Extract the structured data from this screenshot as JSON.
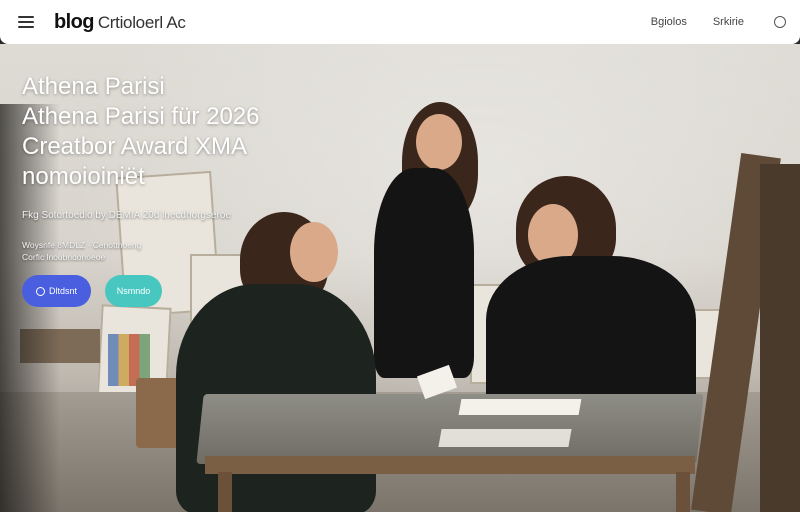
{
  "header": {
    "logo": "blog",
    "subtitle": "Crtioloerl Ac",
    "nav": [
      "Bgiolos",
      "Srkirie"
    ]
  },
  "hero": {
    "title_lines": [
      "Athena Parisi",
      "Athena Parisi für 2026",
      "Creatbor Award XMA",
      "nomoioiniët"
    ],
    "byline": "Fkg Sotortoedio by DEMIA 20d lnecdhorgseroe",
    "meta_lines": [
      "Woysnfe 8MDLZ · Cenottnoeng",
      "Corfic lnoubndonoeoe"
    ],
    "primary_button": "Dltdsnt",
    "secondary_button": "Nsmndo"
  },
  "colors": {
    "primary": "#4a5fe0",
    "secondary": "#47c7c0"
  }
}
